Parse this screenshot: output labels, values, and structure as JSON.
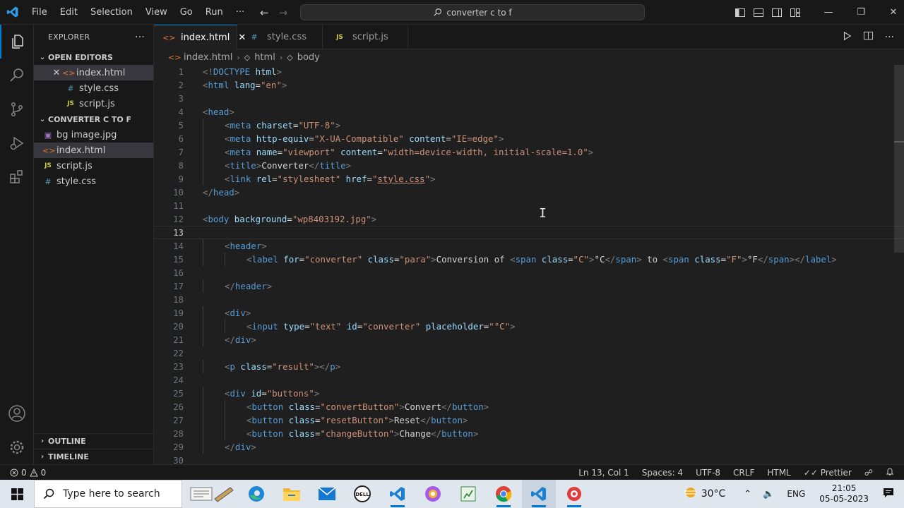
{
  "titlebar": {
    "menu": [
      "File",
      "Edit",
      "Selection",
      "View",
      "Go",
      "Run",
      "···"
    ],
    "search": "converter c to f"
  },
  "explorer": {
    "title": "EXPLORER",
    "open_editors_label": "OPEN EDITORS",
    "open_editors": [
      {
        "name": "index.html",
        "type": "html"
      },
      {
        "name": "style.css",
        "type": "css"
      },
      {
        "name": "script.js",
        "type": "js"
      }
    ],
    "folder_label": "CONVERTER C TO F",
    "files": [
      {
        "name": "bg image.jpg",
        "type": "img"
      },
      {
        "name": "index.html",
        "type": "html"
      },
      {
        "name": "script.js",
        "type": "js"
      },
      {
        "name": "style.css",
        "type": "css"
      }
    ],
    "outline_label": "OUTLINE",
    "timeline_label": "TIMELINE"
  },
  "tabs": [
    {
      "name": "index.html",
      "type": "html",
      "active": true
    },
    {
      "name": "style.css",
      "type": "css",
      "active": false
    },
    {
      "name": "script.js",
      "type": "js",
      "active": false
    }
  ],
  "breadcrumb": [
    "index.html",
    "html",
    "body"
  ],
  "editor": {
    "current_line": 13,
    "lines": [
      {
        "n": 1,
        "indent": 0,
        "tokens": [
          [
            "p",
            "<!"
          ],
          [
            "tag",
            "DOCTYPE"
          ],
          [
            "text",
            " "
          ],
          [
            "attr",
            "html"
          ],
          [
            "p",
            ">"
          ]
        ]
      },
      {
        "n": 2,
        "indent": 0,
        "tokens": [
          [
            "p",
            "<"
          ],
          [
            "tag",
            "html"
          ],
          [
            "text",
            " "
          ],
          [
            "attr",
            "lang"
          ],
          [
            "text",
            "="
          ],
          [
            "str",
            "\"en\""
          ],
          [
            "p",
            ">"
          ]
        ]
      },
      {
        "n": 3,
        "indent": 0,
        "tokens": []
      },
      {
        "n": 4,
        "indent": 0,
        "tokens": [
          [
            "p",
            "<"
          ],
          [
            "tag",
            "head"
          ],
          [
            "p",
            ">"
          ]
        ]
      },
      {
        "n": 5,
        "indent": 1,
        "tokens": [
          [
            "p",
            "<"
          ],
          [
            "tag",
            "meta"
          ],
          [
            "text",
            " "
          ],
          [
            "attr",
            "charset"
          ],
          [
            "text",
            "="
          ],
          [
            "str",
            "\"UTF-8\""
          ],
          [
            "p",
            ">"
          ]
        ]
      },
      {
        "n": 6,
        "indent": 1,
        "tokens": [
          [
            "p",
            "<"
          ],
          [
            "tag",
            "meta"
          ],
          [
            "text",
            " "
          ],
          [
            "attr",
            "http-equiv"
          ],
          [
            "text",
            "="
          ],
          [
            "str",
            "\"X-UA-Compatible\""
          ],
          [
            "text",
            " "
          ],
          [
            "attr",
            "content"
          ],
          [
            "text",
            "="
          ],
          [
            "str",
            "\"IE=edge\""
          ],
          [
            "p",
            ">"
          ]
        ]
      },
      {
        "n": 7,
        "indent": 1,
        "tokens": [
          [
            "p",
            "<"
          ],
          [
            "tag",
            "meta"
          ],
          [
            "text",
            " "
          ],
          [
            "attr",
            "name"
          ],
          [
            "text",
            "="
          ],
          [
            "str",
            "\"viewport\""
          ],
          [
            "text",
            " "
          ],
          [
            "attr",
            "content"
          ],
          [
            "text",
            "="
          ],
          [
            "str",
            "\"width=device-width, initial-scale=1.0\""
          ],
          [
            "p",
            ">"
          ]
        ]
      },
      {
        "n": 8,
        "indent": 1,
        "tokens": [
          [
            "p",
            "<"
          ],
          [
            "tag",
            "title"
          ],
          [
            "p",
            ">"
          ],
          [
            "text",
            "Converter"
          ],
          [
            "p",
            "</"
          ],
          [
            "tag",
            "title"
          ],
          [
            "p",
            ">"
          ]
        ]
      },
      {
        "n": 9,
        "indent": 1,
        "tokens": [
          [
            "p",
            "<"
          ],
          [
            "tag",
            "link"
          ],
          [
            "text",
            " "
          ],
          [
            "attr",
            "rel"
          ],
          [
            "text",
            "="
          ],
          [
            "str",
            "\"stylesheet\""
          ],
          [
            "text",
            " "
          ],
          [
            "attr",
            "href"
          ],
          [
            "text",
            "="
          ],
          [
            "str",
            "\""
          ],
          [
            "stru",
            "style.css"
          ],
          [
            "str",
            "\""
          ],
          [
            "p",
            ">"
          ]
        ]
      },
      {
        "n": 10,
        "indent": 0,
        "tokens": [
          [
            "p",
            "</"
          ],
          [
            "tag",
            "head"
          ],
          [
            "p",
            ">"
          ]
        ]
      },
      {
        "n": 11,
        "indent": 0,
        "tokens": []
      },
      {
        "n": 12,
        "indent": 0,
        "tokens": [
          [
            "p",
            "<"
          ],
          [
            "tag",
            "body"
          ],
          [
            "text",
            " "
          ],
          [
            "attr",
            "background"
          ],
          [
            "text",
            "="
          ],
          [
            "str",
            "\"wp8403192.jpg\""
          ],
          [
            "p",
            ">"
          ]
        ]
      },
      {
        "n": 13,
        "indent": 0,
        "tokens": []
      },
      {
        "n": 14,
        "indent": 1,
        "tokens": [
          [
            "p",
            "<"
          ],
          [
            "tag",
            "header"
          ],
          [
            "p",
            ">"
          ]
        ]
      },
      {
        "n": 15,
        "indent": 2,
        "tokens": [
          [
            "p",
            "<"
          ],
          [
            "tag",
            "label"
          ],
          [
            "text",
            " "
          ],
          [
            "attr",
            "for"
          ],
          [
            "text",
            "="
          ],
          [
            "str",
            "\"converter\""
          ],
          [
            "text",
            " "
          ],
          [
            "attr",
            "class"
          ],
          [
            "text",
            "="
          ],
          [
            "str",
            "\"para\""
          ],
          [
            "p",
            ">"
          ],
          [
            "text",
            "Conversion of "
          ],
          [
            "p",
            "<"
          ],
          [
            "tag",
            "span"
          ],
          [
            "text",
            " "
          ],
          [
            "attr",
            "class"
          ],
          [
            "text",
            "="
          ],
          [
            "str",
            "\"C\""
          ],
          [
            "p",
            ">"
          ],
          [
            "text",
            "°C"
          ],
          [
            "p",
            "</"
          ],
          [
            "tag",
            "span"
          ],
          [
            "p",
            ">"
          ],
          [
            "text",
            " to "
          ],
          [
            "p",
            "<"
          ],
          [
            "tag",
            "span"
          ],
          [
            "text",
            " "
          ],
          [
            "attr",
            "class"
          ],
          [
            "text",
            "="
          ],
          [
            "str",
            "\"F\""
          ],
          [
            "p",
            ">"
          ],
          [
            "text",
            "°F"
          ],
          [
            "p",
            "</"
          ],
          [
            "tag",
            "span"
          ],
          [
            "p",
            ">"
          ],
          [
            "p",
            "</"
          ],
          [
            "tag",
            "label"
          ],
          [
            "p",
            ">"
          ]
        ]
      },
      {
        "n": 16,
        "indent": 0,
        "tokens": []
      },
      {
        "n": 17,
        "indent": 1,
        "tokens": [
          [
            "p",
            "</"
          ],
          [
            "tag",
            "header"
          ],
          [
            "p",
            ">"
          ]
        ]
      },
      {
        "n": 18,
        "indent": 0,
        "tokens": []
      },
      {
        "n": 19,
        "indent": 1,
        "tokens": [
          [
            "p",
            "<"
          ],
          [
            "tag",
            "div"
          ],
          [
            "p",
            ">"
          ]
        ]
      },
      {
        "n": 20,
        "indent": 2,
        "tokens": [
          [
            "p",
            "<"
          ],
          [
            "tag",
            "input"
          ],
          [
            "text",
            " "
          ],
          [
            "attr",
            "type"
          ],
          [
            "text",
            "="
          ],
          [
            "str",
            "\"text\""
          ],
          [
            "text",
            " "
          ],
          [
            "attr",
            "id"
          ],
          [
            "text",
            "="
          ],
          [
            "str",
            "\"converter\""
          ],
          [
            "text",
            " "
          ],
          [
            "attr",
            "placeholder"
          ],
          [
            "text",
            "="
          ],
          [
            "str",
            "\"°C\""
          ],
          [
            "p",
            ">"
          ]
        ]
      },
      {
        "n": 21,
        "indent": 1,
        "tokens": [
          [
            "p",
            "</"
          ],
          [
            "tag",
            "div"
          ],
          [
            "p",
            ">"
          ]
        ]
      },
      {
        "n": 22,
        "indent": 0,
        "tokens": []
      },
      {
        "n": 23,
        "indent": 1,
        "tokens": [
          [
            "p",
            "<"
          ],
          [
            "tag",
            "p"
          ],
          [
            "text",
            " "
          ],
          [
            "attr",
            "class"
          ],
          [
            "text",
            "="
          ],
          [
            "str",
            "\"result\""
          ],
          [
            "p",
            "></"
          ],
          [
            "tag",
            "p"
          ],
          [
            "p",
            ">"
          ]
        ]
      },
      {
        "n": 24,
        "indent": 0,
        "tokens": []
      },
      {
        "n": 25,
        "indent": 1,
        "tokens": [
          [
            "p",
            "<"
          ],
          [
            "tag",
            "div"
          ],
          [
            "text",
            " "
          ],
          [
            "attr",
            "id"
          ],
          [
            "text",
            "="
          ],
          [
            "str",
            "\"buttons\""
          ],
          [
            "p",
            ">"
          ]
        ]
      },
      {
        "n": 26,
        "indent": 2,
        "tokens": [
          [
            "p",
            "<"
          ],
          [
            "tag",
            "button"
          ],
          [
            "text",
            " "
          ],
          [
            "attr",
            "class"
          ],
          [
            "text",
            "="
          ],
          [
            "str",
            "\"convertButton\""
          ],
          [
            "p",
            ">"
          ],
          [
            "text",
            "Convert"
          ],
          [
            "p",
            "</"
          ],
          [
            "tag",
            "button"
          ],
          [
            "p",
            ">"
          ]
        ]
      },
      {
        "n": 27,
        "indent": 2,
        "tokens": [
          [
            "p",
            "<"
          ],
          [
            "tag",
            "button"
          ],
          [
            "text",
            " "
          ],
          [
            "attr",
            "class"
          ],
          [
            "text",
            "="
          ],
          [
            "str",
            "\"resetButton\""
          ],
          [
            "p",
            ">"
          ],
          [
            "text",
            "Reset"
          ],
          [
            "p",
            "</"
          ],
          [
            "tag",
            "button"
          ],
          [
            "p",
            ">"
          ]
        ]
      },
      {
        "n": 28,
        "indent": 2,
        "tokens": [
          [
            "p",
            "<"
          ],
          [
            "tag",
            "button"
          ],
          [
            "text",
            " "
          ],
          [
            "attr",
            "class"
          ],
          [
            "text",
            "="
          ],
          [
            "str",
            "\"changeButton\""
          ],
          [
            "p",
            ">"
          ],
          [
            "text",
            "Change"
          ],
          [
            "p",
            "</"
          ],
          [
            "tag",
            "button"
          ],
          [
            "p",
            ">"
          ]
        ]
      },
      {
        "n": 29,
        "indent": 1,
        "tokens": [
          [
            "p",
            "</"
          ],
          [
            "tag",
            "div"
          ],
          [
            "p",
            ">"
          ]
        ]
      },
      {
        "n": 30,
        "indent": 0,
        "tokens": []
      }
    ]
  },
  "statusbar": {
    "errors": "0",
    "warnings": "0",
    "position": "Ln 13, Col 1",
    "spaces": "Spaces: 4",
    "encoding": "UTF-8",
    "eol": "CRLF",
    "language": "HTML",
    "formatter": "Prettier"
  },
  "taskbar": {
    "search_placeholder": "Type here to search",
    "temperature": "30°C",
    "language": "ENG",
    "time": "21:05",
    "date": "05-05-2023"
  },
  "colors": {
    "accent": "#0078d4",
    "tag": "#569cd6",
    "attr": "#9cdcfe",
    "string": "#ce9178"
  }
}
